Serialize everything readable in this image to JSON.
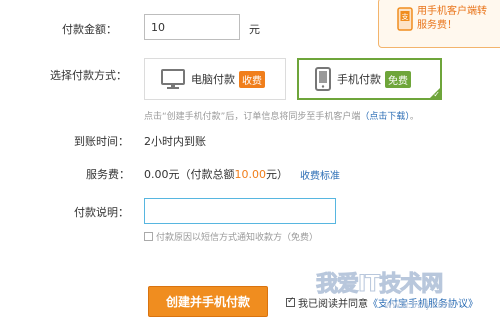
{
  "amount": {
    "label": "付款金额：",
    "value": "10",
    "unit": "元"
  },
  "method": {
    "label": "选择付款方式：",
    "options": [
      {
        "label": "电脑付款",
        "badge": "收费",
        "icon": "monitor-icon"
      },
      {
        "label": "手机付款",
        "badge": "免费",
        "icon": "phone-icon"
      }
    ],
    "selected": "手机付款",
    "hint_prefix": "点击“创建手机付款”后，订单信息将同步至手机客户端",
    "hint_link": "（点击下载）",
    "hint_suffix": "。"
  },
  "arrival": {
    "label": "到账时间：",
    "value": "2小时内到账"
  },
  "fee": {
    "label": "服务费：",
    "value_prefix": "0.00元（付款总额",
    "total": "10.00",
    "value_suffix": "元）",
    "standard_link": "收费标准"
  },
  "note": {
    "label": "付款说明：",
    "value": ""
  },
  "sms": {
    "checked": false,
    "label": "付款原因以短信方式通知收款方（免费）"
  },
  "submit": {
    "label": "创建并手机付款"
  },
  "agree": {
    "checked": true,
    "text": "我已阅读并同意",
    "link": "《支付宝手机服务协议》"
  },
  "popup": {
    "line1": "用手机客户端转",
    "line2": "服务费！",
    "icon": "alipay-icon"
  },
  "watermark": {
    "text": "我爱IT技术网",
    "url": "www.52ij.com"
  },
  "colors": {
    "accent": "#f08d1f",
    "selected": "#6ea53a",
    "link": "#2b6db5",
    "input_focus": "#57b6e0"
  }
}
